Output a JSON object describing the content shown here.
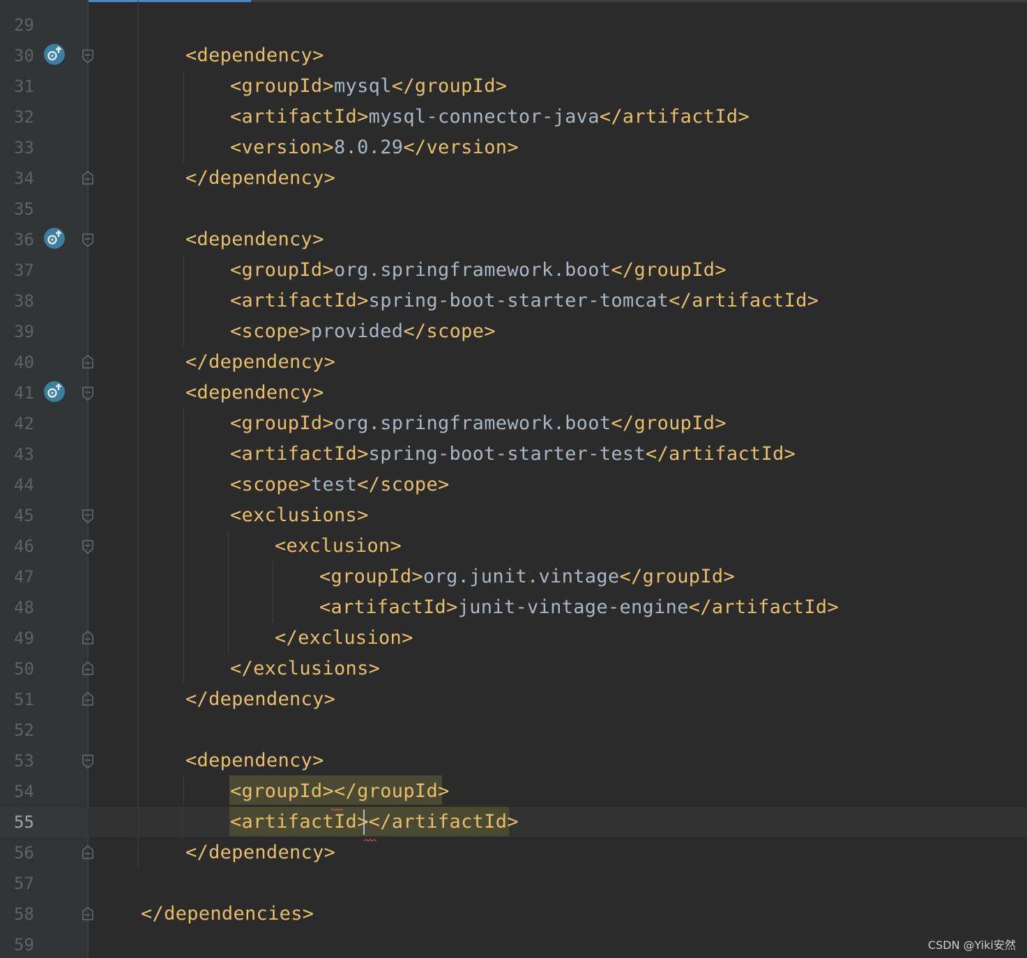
{
  "colors": {
    "background": "#2b2b2b",
    "gutter": "#313335",
    "tag": "#e8bf6a",
    "text": "#a9b7c6",
    "line_number": "#606366",
    "accent_tab": "#4a88c7",
    "match_highlight": "#4a4a33",
    "error_squiggle": "#d45050",
    "maven_icon": "#3a7ea0"
  },
  "watermark": "CSDN @Yiki安然",
  "current_line": 55,
  "gutter": {
    "line_numbers": [
      "29",
      "30",
      "31",
      "32",
      "33",
      "34",
      "35",
      "36",
      "37",
      "38",
      "39",
      "40",
      "41",
      "42",
      "43",
      "44",
      "45",
      "46",
      "47",
      "48",
      "49",
      "50",
      "51",
      "52",
      "53",
      "54",
      "55",
      "56",
      "57",
      "58",
      "59"
    ],
    "maven_icons": [
      "maven-dependency-update-icon",
      "maven-dependency-update-icon",
      "maven-dependency-update-icon"
    ]
  },
  "code": {
    "line30": {
      "open": "<dependency>"
    },
    "line31": {
      "open": "<groupId>",
      "text": "mysql",
      "close": "</groupId>"
    },
    "line32": {
      "open": "<artifactId>",
      "text": "mysql-connector-java",
      "close": "</artifactId>"
    },
    "line33": {
      "open": "<version>",
      "text": "8.0.29",
      "close": "</version>"
    },
    "line34": {
      "close": "</dependency>"
    },
    "line36": {
      "open": "<dependency>"
    },
    "line37": {
      "open": "<groupId>",
      "text": "org.springframework.boot",
      "close": "</groupId>"
    },
    "line38": {
      "open": "<artifactId>",
      "text": "spring-boot-starter-tomcat",
      "close": "</artifactId>"
    },
    "line39": {
      "open": "<scope>",
      "text": "provided",
      "close": "</scope>"
    },
    "line40": {
      "close": "</dependency>"
    },
    "line41": {
      "open": "<dependency>"
    },
    "line42": {
      "open": "<groupId>",
      "text": "org.springframework.boot",
      "close": "</groupId>"
    },
    "line43": {
      "open": "<artifactId>",
      "text": "spring-boot-starter-test",
      "close": "</artifactId>"
    },
    "line44": {
      "open": "<scope>",
      "text": "test",
      "close": "</scope>"
    },
    "line45": {
      "open": "<exclusions>"
    },
    "line46": {
      "open": "<exclusion>"
    },
    "line47": {
      "open": "<groupId>",
      "text": "org.junit.vintage",
      "close": "</groupId>"
    },
    "line48": {
      "open": "<artifactId>",
      "text": "junit-vintage-engine",
      "close": "</artifactId>"
    },
    "line49": {
      "close": "</exclusion>"
    },
    "line50": {
      "close": "</exclusions>"
    },
    "line51": {
      "close": "</dependency>"
    },
    "line53": {
      "open": "<dependency>"
    },
    "line54": {
      "open": "<groupId>",
      "close": "</groupId>"
    },
    "line55": {
      "open": "<artifactId>",
      "close": "</artifactId>"
    },
    "line56": {
      "close": "</dependency>"
    },
    "line58": {
      "close": "</dependencies>"
    }
  }
}
